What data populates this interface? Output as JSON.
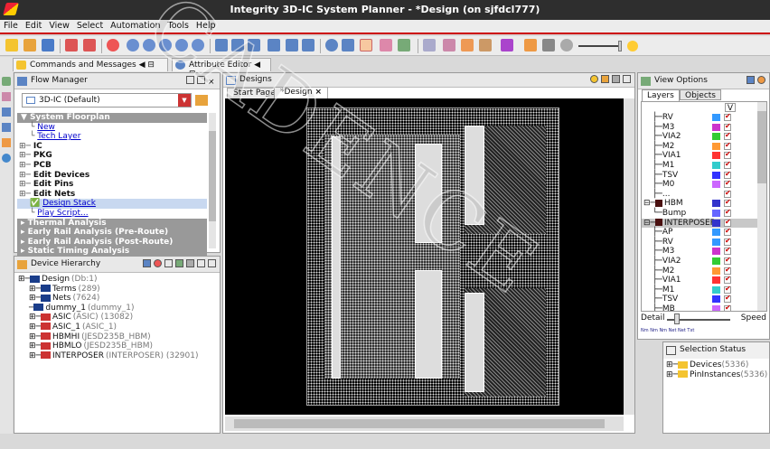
{
  "window": {
    "title": "Integrity 3D-IC System Planner - *Design (on sjfdcl777)"
  },
  "menu": [
    "File",
    "Edit",
    "View",
    "Select",
    "Automation",
    "Tools",
    "Help"
  ],
  "panel_tabs": {
    "commands": "Commands and Messages",
    "attribute": "Attribute Editor"
  },
  "flow_manager": {
    "title": "Flow Manager",
    "dropdown": "3D-IC (Default)",
    "tree": [
      {
        "text": "▼ System Floorplan",
        "style": "sec"
      },
      {
        "text": "New",
        "style": "link",
        "indent": 1
      },
      {
        "text": "Tech Layer",
        "style": "link",
        "indent": 1
      },
      {
        "text": "IC",
        "style": "bold",
        "exp": "⊞"
      },
      {
        "text": "PKG",
        "style": "bold",
        "exp": "⊞"
      },
      {
        "text": "PCB",
        "style": "bold",
        "exp": "⊞"
      },
      {
        "text": "Edit Devices",
        "style": "bold",
        "exp": "⊞"
      },
      {
        "text": "Edit Pins",
        "style": "bold",
        "exp": "⊞"
      },
      {
        "text": "Edit Nets",
        "style": "bold",
        "exp": "⊞"
      },
      {
        "text": "Design Stack",
        "style": "link",
        "indent": 1,
        "check": true
      },
      {
        "text": "Play Script...",
        "style": "link",
        "indent": 1
      },
      {
        "text": "▸ Thermal Analysis",
        "style": "sec"
      },
      {
        "text": "▸ Early Rail Analysis (Pre-Route)",
        "style": "sec"
      },
      {
        "text": "▸ Early Rail Analysis (Post-Route)",
        "style": "sec"
      },
      {
        "text": "▸ Static Timing Analysis",
        "style": "sec"
      }
    ]
  },
  "device_hierarchy": {
    "title": "Device Hierarchy",
    "tree": [
      {
        "name": "Design",
        "detail": "(Db:1)",
        "level": 0
      },
      {
        "name": "Terms",
        "detail": "(289)",
        "level": 1
      },
      {
        "name": "Nets",
        "detail": "(7624)",
        "level": 1
      },
      {
        "name": "dummy_1",
        "detail": "(dummy_1)",
        "level": 1
      },
      {
        "name": "ASIC",
        "detail": "(ASIC) (13082)",
        "level": 1
      },
      {
        "name": "ASIC_1",
        "detail": "(ASIC_1)",
        "level": 1
      },
      {
        "name": "HBMHI",
        "detail": "(JESD235B_HBM)",
        "level": 1
      },
      {
        "name": "HBMLO",
        "detail": "(JESD235B_HBM)",
        "level": 1
      },
      {
        "name": "INTERPOSER",
        "detail": "(INTERPOSER) (32901)",
        "level": 1
      }
    ]
  },
  "designs": {
    "title": "Designs",
    "tabs": [
      "Start Page",
      "*Design"
    ]
  },
  "view_options": {
    "title": "View Options",
    "tabs": [
      "Layers",
      "Objects"
    ],
    "col_v": "V",
    "layers": [
      {
        "name": "RV",
        "color": "#3399ff",
        "level": 2
      },
      {
        "name": "M3",
        "color": "#cc33cc",
        "level": 2
      },
      {
        "name": "VIA2",
        "color": "#33cc33",
        "level": 2
      },
      {
        "name": "M2",
        "color": "#ff9933",
        "level": 2
      },
      {
        "name": "VIA1",
        "color": "#ff3333",
        "level": 2
      },
      {
        "name": "M1",
        "color": "#33cccc",
        "level": 2
      },
      {
        "name": "TSV",
        "color": "#3333ff",
        "level": 2
      },
      {
        "name": "M0",
        "color": "#cc66ff",
        "level": 2
      },
      {
        "name": "...",
        "color": "",
        "level": 2
      },
      {
        "name": "HBM",
        "color": "#3333cc",
        "level": 0,
        "group": true
      },
      {
        "name": "Bump",
        "color": "#6666ff",
        "level": 1
      },
      {
        "name": "INTERPOSER",
        "color": "#3333cc",
        "level": 0,
        "group": true,
        "sel": true
      },
      {
        "name": "AP",
        "color": "#3399ff",
        "level": 2
      },
      {
        "name": "RV",
        "color": "#3399ff",
        "level": 2
      },
      {
        "name": "M3",
        "color": "#cc33cc",
        "level": 2
      },
      {
        "name": "VIA2",
        "color": "#33cc33",
        "level": 2
      },
      {
        "name": "M2",
        "color": "#ff9933",
        "level": 2
      },
      {
        "name": "VIA1",
        "color": "#ff3333",
        "level": 2
      },
      {
        "name": "M1",
        "color": "#33cccc",
        "level": 2
      },
      {
        "name": "TSV",
        "color": "#3333ff",
        "level": 2
      },
      {
        "name": "MB",
        "color": "#cc66ff",
        "level": 2
      },
      {
        "name": "...",
        "color": "",
        "level": 2
      }
    ],
    "detail": "Detail",
    "speed": "Speed",
    "small_labels": [
      "Nm",
      "Nm",
      "Nm",
      "Net",
      "Net",
      "Txt"
    ]
  },
  "selection_status": {
    "title": "Selection Status",
    "items": [
      {
        "name": "Devices",
        "count": "(5336)"
      },
      {
        "name": "PinInstances",
        "count": "(5336)"
      }
    ]
  },
  "watermark": "CADENCE"
}
